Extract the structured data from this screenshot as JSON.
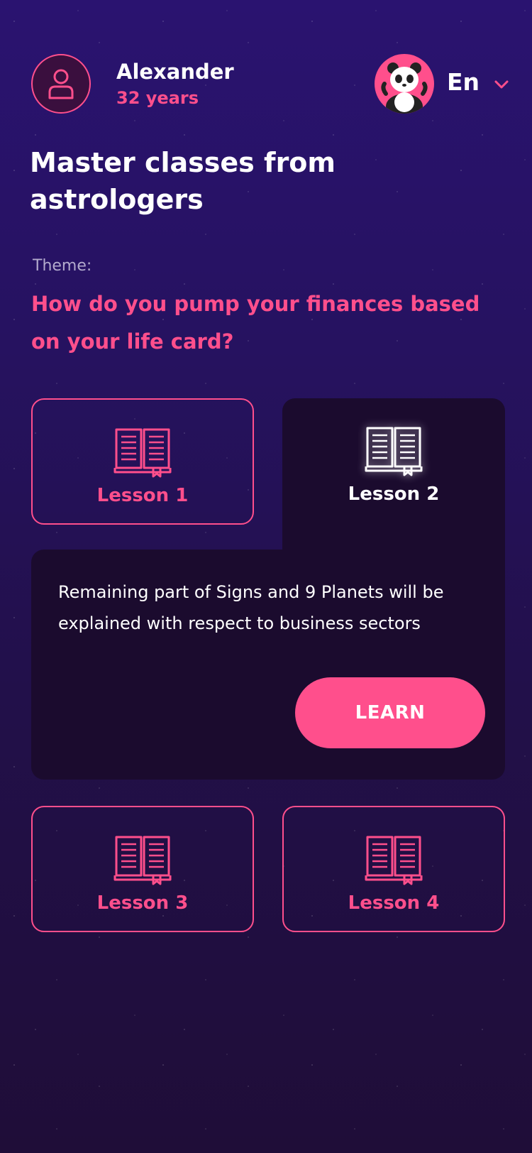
{
  "user": {
    "name": "Alexander",
    "age": "32 years"
  },
  "language": {
    "selected": "En"
  },
  "page": {
    "title": "Master classes from astrologers",
    "theme_label": "Theme:",
    "theme_text": "How do you pump your finances based on your life card?"
  },
  "lessons": [
    {
      "label": "Lesson 1",
      "active": false
    },
    {
      "label": "Lesson 2",
      "active": true
    },
    {
      "label": "Lesson 3",
      "active": false
    },
    {
      "label": "Lesson 4",
      "active": false
    }
  ],
  "active_lesson": {
    "description": "Remaining part of Signs and 9 Planets will be explained with respect to business sectors",
    "button_label": "LEARN"
  },
  "colors": {
    "accent": "#ff4f8c",
    "panel": "#1b0b2e",
    "background": "#2a1370"
  },
  "icons": [
    "user-icon",
    "panda-avatar-icon",
    "chevron-down-icon",
    "book-icon"
  ]
}
